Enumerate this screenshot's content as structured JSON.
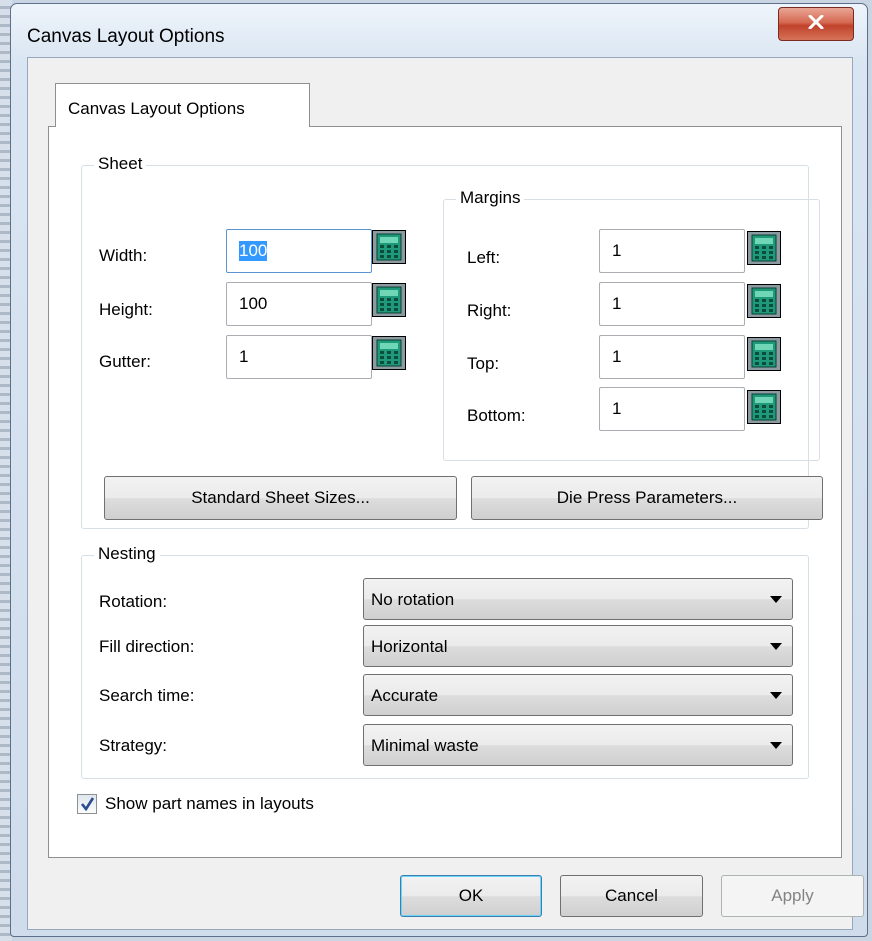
{
  "window": {
    "title": "Canvas Layout Options",
    "close_glyph": "X"
  },
  "tab": {
    "label": "Canvas Layout Options"
  },
  "sheet": {
    "group_label": "Sheet",
    "width": {
      "label": "Width:",
      "value": "100"
    },
    "height": {
      "label": "Height:",
      "value": "100"
    },
    "gutter": {
      "label": "Gutter:",
      "value": "1"
    },
    "margins": {
      "group_label": "Margins",
      "left": {
        "label": "Left:",
        "value": "1"
      },
      "right": {
        "label": "Right:",
        "value": "1"
      },
      "top": {
        "label": "Top:",
        "value": "1"
      },
      "bottom": {
        "label": "Bottom:",
        "value": "1"
      }
    },
    "standard_sheet_sizes_label": "Standard Sheet Sizes...",
    "die_press_parameters_label": "Die Press Parameters..."
  },
  "nesting": {
    "group_label": "Nesting",
    "rotation": {
      "label": "Rotation:",
      "value": "No rotation"
    },
    "fill_direction": {
      "label": "Fill direction:",
      "value": "Horizontal"
    },
    "search_time": {
      "label": "Search time:",
      "value": "Accurate"
    },
    "strategy": {
      "label": "Strategy:",
      "value": "Minimal waste"
    }
  },
  "show_part_names": {
    "label": "Show part names in layouts",
    "checked": true
  },
  "buttons": {
    "ok": "OK",
    "cancel": "Cancel",
    "apply": "Apply"
  },
  "icons": {
    "calculator": "calculator-icon",
    "close": "close-icon",
    "dropdown": "chevron-down-icon",
    "check": "checkmark-icon"
  },
  "colors": {
    "selection": "#3399ff",
    "close_button": "#c1412a",
    "calculator": "#1e9a7a"
  }
}
